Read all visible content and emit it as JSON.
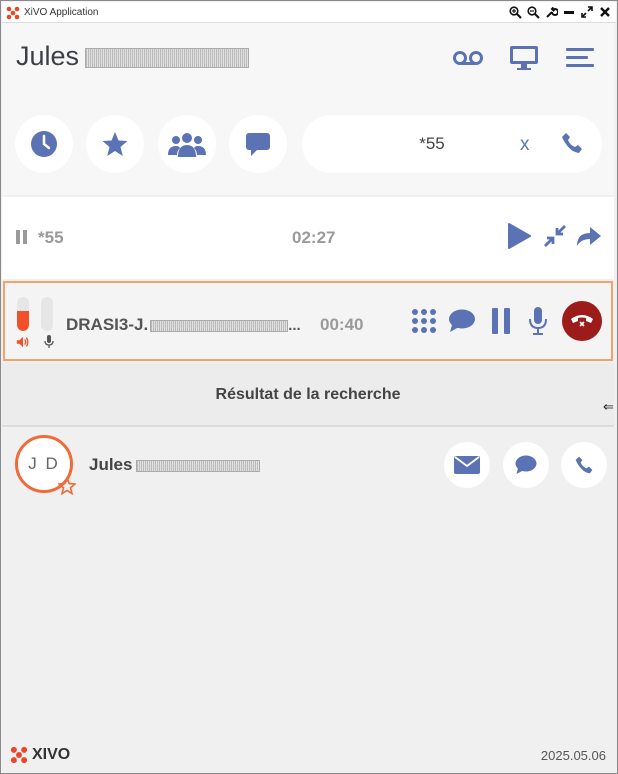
{
  "window": {
    "title": "XiVO Application",
    "controls": [
      "zoom-in-icon",
      "zoom-out-icon",
      "wrench-icon",
      "minimize-icon",
      "maximize-icon",
      "close-icon"
    ]
  },
  "header": {
    "user_first_name": "Jules",
    "icons": [
      "voicemail-icon",
      "monitor-icon",
      "menu-icon"
    ]
  },
  "toolbar": {
    "buttons": [
      "history-clock-icon",
      "favorites-star-icon",
      "group-icon",
      "chat-icon"
    ],
    "search_value": "*55",
    "clear_label": "x"
  },
  "held_call": {
    "number": "*55",
    "duration": "02:27",
    "actions": [
      "resume-play-icon",
      "conference-merge-icon",
      "transfer-icon"
    ]
  },
  "active_call": {
    "caller": "DRASI3-J.",
    "caller_ellipsis": "...",
    "duration": "00:40",
    "speaker_level": 0.6,
    "mic_level": 0,
    "actions": [
      "dialpad-icon",
      "chat-icon",
      "hold-icon",
      "mute-mic-icon",
      "hangup-icon"
    ]
  },
  "results": {
    "title": "Résultat de la recherche",
    "contacts": [
      {
        "initials": "J D",
        "first_name": "Jules",
        "favorite": true,
        "actions": [
          "email-icon",
          "chat-icon",
          "call-icon"
        ]
      }
    ]
  },
  "footer": {
    "brand": "XIVO",
    "version": "2025.05.06"
  },
  "colors": {
    "accent_blue": "#5b73b5",
    "accent_orange": "#f06a3a",
    "hangup_red": "#9c1b1b",
    "active_border": "#f0a46c"
  }
}
